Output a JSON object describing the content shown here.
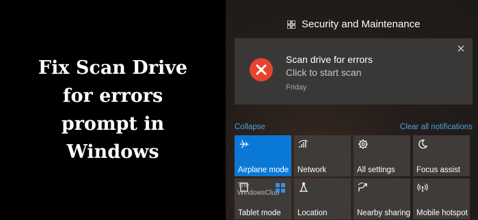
{
  "headline": [
    "Fix Scan Drive",
    "for errors",
    "prompt in",
    "Windows"
  ],
  "action_center": {
    "header_title": "Security and Maintenance",
    "notification": {
      "title": "Scan drive for errors",
      "subtitle": "Click to start scan",
      "time": "Friday",
      "icon": "error-x-icon",
      "icon_color": "#e8432f"
    },
    "collapse_label": "Collapse",
    "clear_label": "Clear all notifications",
    "accent_color": "#0a78d7",
    "tiles": [
      {
        "label": "Airplane mode",
        "icon": "airplane-icon",
        "active": true
      },
      {
        "label": "Network",
        "icon": "network-icon",
        "active": false
      },
      {
        "label": "All settings",
        "icon": "gear-icon",
        "active": false
      },
      {
        "label": "Focus assist",
        "icon": "moon-icon",
        "active": false
      },
      {
        "label": "Tablet mode",
        "icon": "tablet-icon",
        "active": false
      },
      {
        "label": "Location",
        "icon": "location-icon",
        "active": false
      },
      {
        "label": "Nearby sharing",
        "icon": "share-icon",
        "active": false
      },
      {
        "label": "Mobile hotspot",
        "icon": "hotspot-icon",
        "active": false
      }
    ]
  },
  "watermark": [
    "The",
    "WindowsClub"
  ]
}
